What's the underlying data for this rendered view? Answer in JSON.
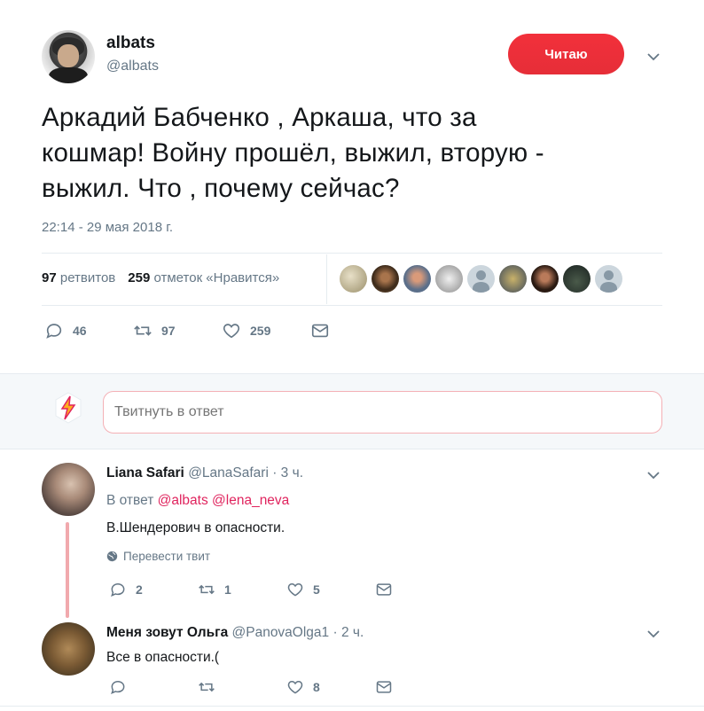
{
  "tweet": {
    "display_name": "albats",
    "handle": "@albats",
    "follow_label": "Читаю",
    "text_line1": "Аркадий Бабченко , Аркаша, что за",
    "text_line2": "кошмар! Войну прошёл, выжил, вторую -",
    "text_line3": "выжил. Что , почему сейчас?",
    "timestamp": "22:14 - 29 мая 2018 г.",
    "retweets_count": "97",
    "retweets_label": "ретвитов",
    "likes_count": "259",
    "likes_label": "отметок «Нравится»",
    "actions": {
      "replies": "46",
      "retweets": "97",
      "likes": "259"
    }
  },
  "reply_box": {
    "placeholder": "Твитнуть в ответ"
  },
  "replies": [
    {
      "name": "Liana Safari",
      "handle": "@LanaSafari",
      "time": "· 3 ч.",
      "in_reply_prefix": "В ответ",
      "mention1": "@albats",
      "mention2": "@lena_neva",
      "text": "В.Шендерович в опасности.",
      "translate": "Перевести твит",
      "replies": "2",
      "retweets": "1",
      "likes": "5"
    },
    {
      "name": "Меня зовут Ольга",
      "handle": "@PanovaOlga1",
      "time": "· 2 ч.",
      "text": "Все в опасности.(",
      "replies": "",
      "retweets": "",
      "likes": "8"
    }
  ],
  "colors": {
    "accent_red": "#e0245e",
    "button_red": "#e62e38",
    "muted": "#657786",
    "text": "#14171a"
  },
  "icons": [
    "chevron-down-icon",
    "reply-icon",
    "retweet-icon",
    "like-icon",
    "dm-icon",
    "globe-icon",
    "user-avatar-icon"
  ]
}
